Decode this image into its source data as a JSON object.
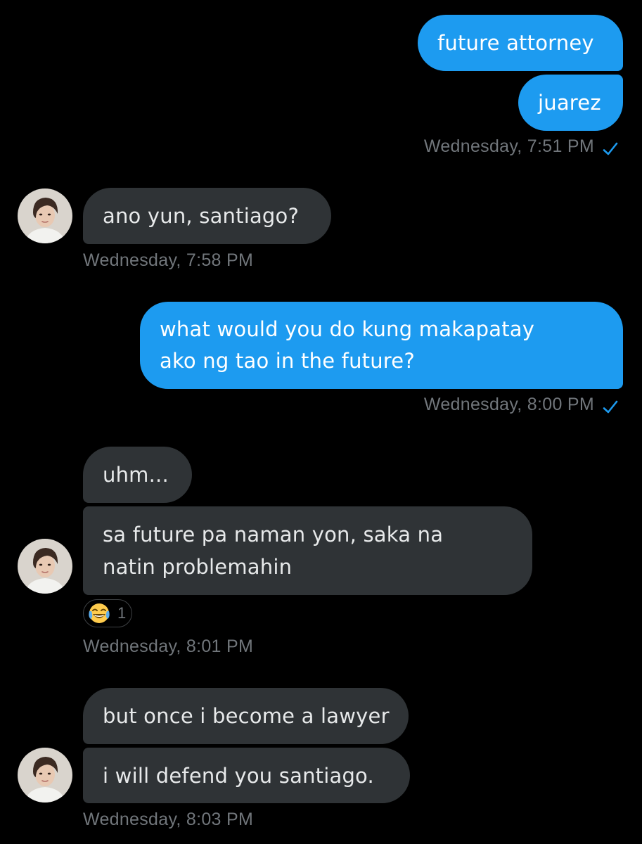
{
  "colors": {
    "background": "#000000",
    "sent_bubble": "#1d9bf0",
    "received_bubble": "#2f3336",
    "timestamp": "#71767b",
    "read_check": "#1d9bf0"
  },
  "messages": [
    {
      "sender": "me",
      "text": "future attorney"
    },
    {
      "sender": "me",
      "text": "juarez"
    },
    {
      "sender": "me",
      "timestamp": "Wednesday, 7:51 PM",
      "status_icon": "read-check-icon"
    },
    {
      "sender": "them",
      "text": "ano yun, santiago?"
    },
    {
      "sender": "them",
      "timestamp": "Wednesday, 7:58 PM"
    },
    {
      "sender": "me",
      "text_lines": [
        "what would you do kung makapatay",
        "ako ng tao in the future?"
      ]
    },
    {
      "sender": "me",
      "timestamp": "Wednesday, 8:00 PM",
      "status_icon": "read-check-icon"
    },
    {
      "sender": "them",
      "text": "uhm..."
    },
    {
      "sender": "them",
      "text_lines": [
        "sa future pa naman yon, saka na",
        "natin problemahin"
      ],
      "reaction": {
        "emoji_icon": "tears-of-joy-emoji-icon",
        "count": "1"
      }
    },
    {
      "sender": "them",
      "timestamp": "Wednesday, 8:01 PM"
    },
    {
      "sender": "them",
      "text": "but once i become a lawyer"
    },
    {
      "sender": "them",
      "text": "i will defend you santiago."
    },
    {
      "sender": "them",
      "timestamp": "Wednesday, 8:03 PM"
    }
  ]
}
